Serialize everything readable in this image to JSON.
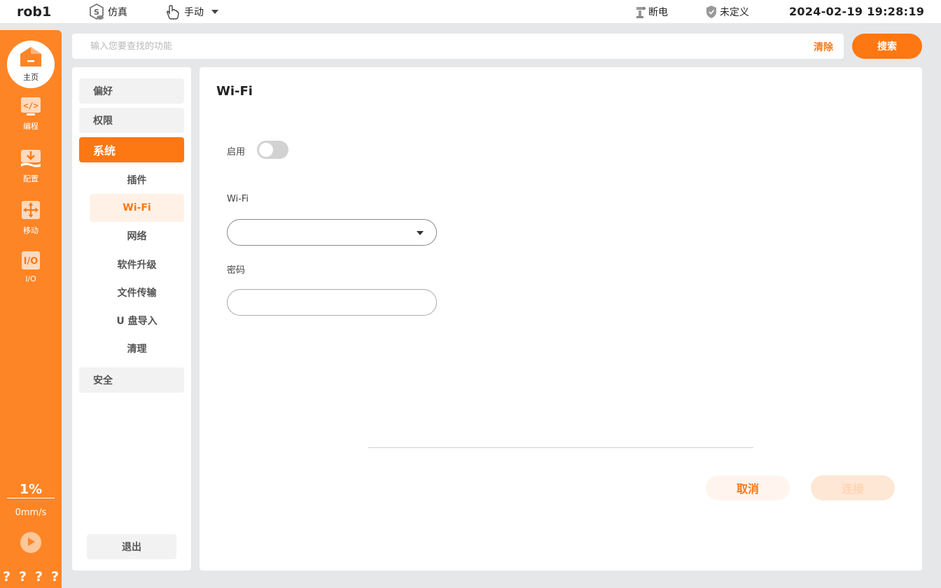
{
  "topbar": {
    "robot_name": "rob1",
    "sim_label": "仿真",
    "mode_label": "手动",
    "power_label": "断电",
    "safety_label": "未定义",
    "datetime": "2024-02-19 19:28:19"
  },
  "sidebar": {
    "home": "主页",
    "items": [
      {
        "label": "编程",
        "icon": "code-icon"
      },
      {
        "label": "配置",
        "icon": "config-download-icon"
      },
      {
        "label": "移动",
        "icon": "move-arrows-icon"
      },
      {
        "label": "I/O",
        "icon": "io-icon"
      }
    ],
    "speed_percent": "1%",
    "speed_value": "0mm/s",
    "status_marks": [
      "?",
      "?",
      "?",
      "?"
    ]
  },
  "search": {
    "placeholder": "输入您要查找的功能",
    "value": "",
    "clear_label": "清除",
    "button_label": "搜索"
  },
  "menu": {
    "categories": [
      "偏好",
      "权限",
      "系统",
      "安全"
    ],
    "active_category": "系统",
    "system_items": [
      "插件",
      "Wi-Fi",
      "网络",
      "软件升级",
      "文件传输",
      "U 盘导入",
      "清理"
    ],
    "active_item": "Wi-Fi",
    "logout_label": "退出"
  },
  "content": {
    "title": "Wi-Fi",
    "enable_label": "启用",
    "enabled": false,
    "wifi_label": "Wi-Fi",
    "wifi_selected": "",
    "password_label": "密码",
    "password_value": "",
    "cancel_label": "取消",
    "connect_label": "连接"
  },
  "colors": {
    "accent": "#fd7712",
    "sidebar": "#fd8526",
    "background": "#e6e7e9"
  }
}
